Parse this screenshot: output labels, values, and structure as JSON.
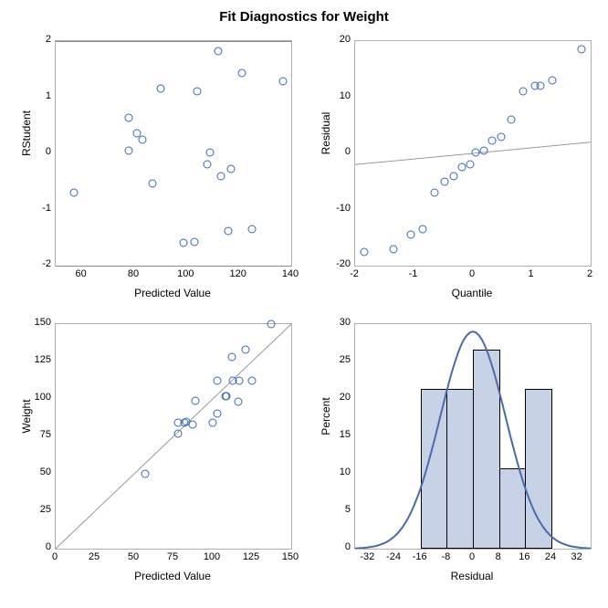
{
  "title": "Fit Diagnostics for Weight",
  "chart_data": [
    {
      "type": "scatter",
      "title": "",
      "xlabel": "Predicted Value",
      "ylabel": "RStudent",
      "xlim": [
        50,
        140
      ],
      "ylim": [
        -2,
        2
      ],
      "xticks": [
        60,
        80,
        100,
        120,
        140
      ],
      "yticks": [
        -2,
        -1,
        0,
        1,
        2
      ],
      "reflines_y": [
        -2,
        2
      ],
      "points": [
        {
          "x": 57,
          "y": -0.7
        },
        {
          "x": 78,
          "y": 0.63
        },
        {
          "x": 78,
          "y": 0.05
        },
        {
          "x": 81,
          "y": 0.35
        },
        {
          "x": 83,
          "y": 0.25
        },
        {
          "x": 87,
          "y": -0.53
        },
        {
          "x": 90,
          "y": 1.16
        },
        {
          "x": 99,
          "y": -1.6
        },
        {
          "x": 103,
          "y": -1.58
        },
        {
          "x": 104,
          "y": 1.1
        },
        {
          "x": 108,
          "y": -0.2
        },
        {
          "x": 109,
          "y": 0.02
        },
        {
          "x": 112,
          "y": 1.82
        },
        {
          "x": 113,
          "y": -0.4
        },
        {
          "x": 116,
          "y": -1.38
        },
        {
          "x": 117,
          "y": -0.27
        },
        {
          "x": 121,
          "y": 1.43
        },
        {
          "x": 125,
          "y": -1.35
        },
        {
          "x": 137,
          "y": 1.28
        }
      ]
    },
    {
      "type": "scatter",
      "title": "",
      "xlabel": "Quantile",
      "ylabel": "Residual",
      "xlim": [
        -2,
        2
      ],
      "ylim": [
        -20,
        20
      ],
      "xticks": [
        -2,
        -1,
        0,
        1,
        2
      ],
      "yticks": [
        -20,
        -10,
        0,
        10,
        20
      ],
      "refline_diag": true,
      "points": [
        {
          "x": -1.85,
          "y": -17.5
        },
        {
          "x": -1.35,
          "y": -17.0
        },
        {
          "x": -1.05,
          "y": -14.5
        },
        {
          "x": -0.85,
          "y": -13.5
        },
        {
          "x": -0.65,
          "y": -7.0
        },
        {
          "x": -0.48,
          "y": -5.0
        },
        {
          "x": -0.32,
          "y": -4.0
        },
        {
          "x": -0.18,
          "y": -2.5
        },
        {
          "x": -0.05,
          "y": -2.0
        },
        {
          "x": 0.05,
          "y": 0.2
        },
        {
          "x": 0.18,
          "y": 0.5
        },
        {
          "x": 0.32,
          "y": 2.3
        },
        {
          "x": 0.48,
          "y": 3.0
        },
        {
          "x": 0.65,
          "y": 6.0
        },
        {
          "x": 0.85,
          "y": 11.0
        },
        {
          "x": 1.05,
          "y": 12.0
        },
        {
          "x": 1.15,
          "y": 12.0
        },
        {
          "x": 1.35,
          "y": 13.0
        },
        {
          "x": 1.85,
          "y": 18.5
        }
      ]
    },
    {
      "type": "scatter",
      "title": "",
      "xlabel": "Predicted Value",
      "ylabel": "Weight",
      "xlim": [
        0,
        150
      ],
      "ylim": [
        0,
        150
      ],
      "xticks": [
        0,
        25,
        50,
        75,
        100,
        125,
        150
      ],
      "yticks": [
        0,
        25,
        50,
        75,
        100,
        125,
        150
      ],
      "refline_diag": true,
      "points": [
        {
          "x": 57,
          "y": 50
        },
        {
          "x": 78,
          "y": 84
        },
        {
          "x": 78,
          "y": 77
        },
        {
          "x": 82,
          "y": 84
        },
        {
          "x": 83,
          "y": 85
        },
        {
          "x": 87,
          "y": 83
        },
        {
          "x": 89,
          "y": 99
        },
        {
          "x": 100,
          "y": 84
        },
        {
          "x": 103,
          "y": 90
        },
        {
          "x": 103,
          "y": 112
        },
        {
          "x": 108,
          "y": 102
        },
        {
          "x": 109,
          "y": 102
        },
        {
          "x": 112,
          "y": 128
        },
        {
          "x": 113,
          "y": 112
        },
        {
          "x": 116,
          "y": 98
        },
        {
          "x": 117,
          "y": 112
        },
        {
          "x": 121,
          "y": 133
        },
        {
          "x": 125,
          "y": 112
        },
        {
          "x": 137,
          "y": 150
        }
      ]
    },
    {
      "type": "bar",
      "title": "",
      "xlabel": "Residual",
      "ylabel": "Percent",
      "xlim": [
        -36,
        36
      ],
      "ylim": [
        0,
        30
      ],
      "xticks": [
        -32,
        -24,
        -16,
        -8,
        0,
        8,
        16,
        24,
        32
      ],
      "yticks": [
        0,
        5,
        10,
        15,
        20,
        25,
        30
      ],
      "bin_width": 8,
      "bars": [
        {
          "center": -12,
          "value": 21.05
        },
        {
          "center": -4,
          "value": 21.05
        },
        {
          "center": 4,
          "value": 26.32
        },
        {
          "center": 12,
          "value": 10.53
        },
        {
          "center": 20,
          "value": 21.05
        }
      ],
      "normal_curve": {
        "mean": 0,
        "sd": 10,
        "peak": 29
      }
    }
  ],
  "labels": {
    "p1x": "Predicted Value",
    "p1y": "RStudent",
    "p2x": "Quantile",
    "p2y": "Residual",
    "p3x": "Predicted Value",
    "p3y": "Weight",
    "p4x": "Residual",
    "p4y": "Percent"
  }
}
